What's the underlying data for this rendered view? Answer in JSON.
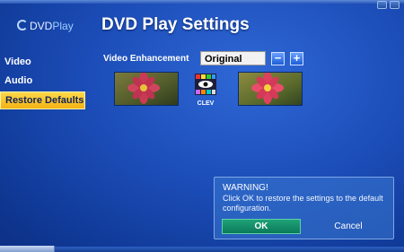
{
  "app": {
    "logo_prefix": "DVD",
    "logo_suffix": "Play",
    "title": "DVD Play Settings"
  },
  "sidebar": {
    "items": [
      {
        "label": "Video",
        "active": false
      },
      {
        "label": "Audio",
        "active": false
      },
      {
        "label": "Restore Defaults",
        "active": true
      }
    ]
  },
  "settings": {
    "video_enhancement_label": "Video Enhancement",
    "video_enhancement_value": "Original",
    "decrease_label": "−",
    "increase_label": "+",
    "clev_label": "CLEV"
  },
  "dialog": {
    "heading": "WARNING!",
    "message": "Click OK to restore the settings to the default configuration.",
    "ok_label": "OK",
    "cancel_label": "Cancel"
  },
  "colors": {
    "background": "#1c4db8",
    "active_item": "#ffd84a",
    "ok_button": "#11916a"
  }
}
